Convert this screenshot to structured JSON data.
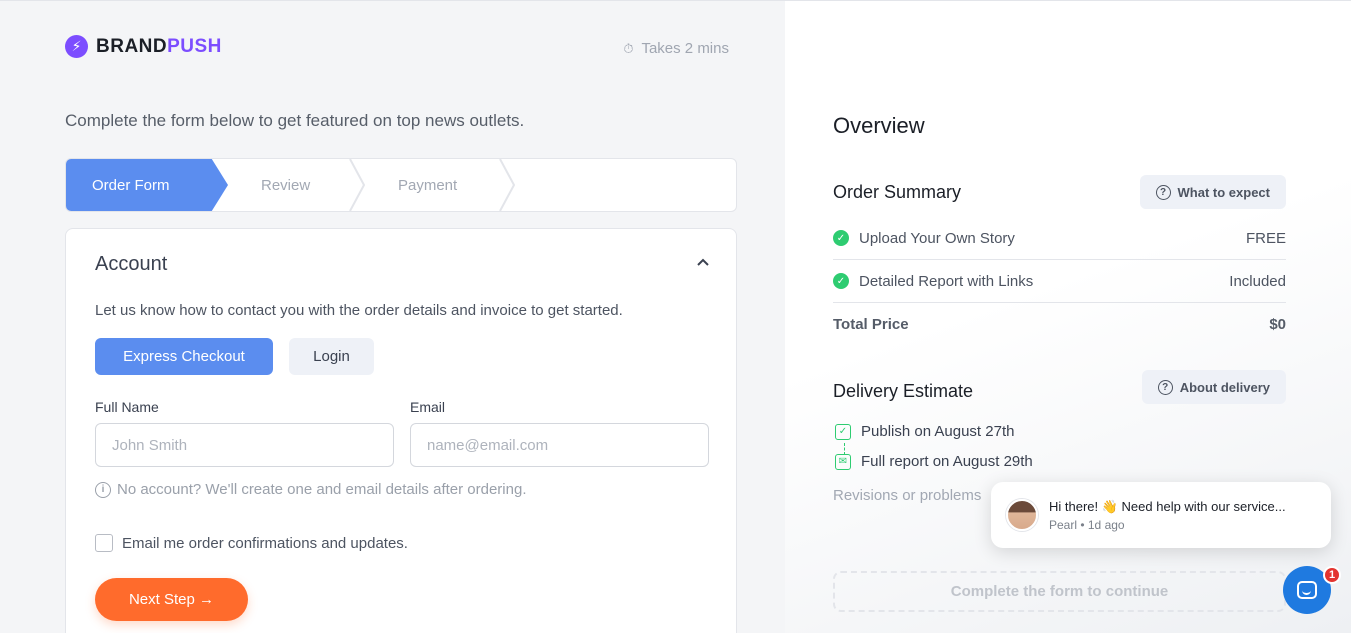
{
  "brand": {
    "name_part1": "BRAND",
    "name_part2": "PUSH",
    "accent_color": "#7c4dff"
  },
  "takes": {
    "label": "Takes 2 mins"
  },
  "intro": "Complete the form below to get featured on top news outlets.",
  "steps": [
    {
      "label": "Order Form",
      "active": true
    },
    {
      "label": "Review",
      "active": false
    },
    {
      "label": "Payment",
      "active": false
    }
  ],
  "account": {
    "title": "Account",
    "description": "Let us know how to contact you with the order details and invoice to get started.",
    "express_label": "Express Checkout",
    "login_label": "Login",
    "full_name": {
      "label": "Full Name",
      "placeholder": "John Smith",
      "value": ""
    },
    "email": {
      "label": "Email",
      "placeholder": "name@email.com",
      "value": ""
    },
    "hint": "No account? We'll create one and email details after ordering.",
    "updates_checkbox": {
      "label": "Email me order confirmations and updates.",
      "checked": false
    },
    "next_label": "Next Step →"
  },
  "overview": {
    "title": "Overview",
    "order_summary": {
      "title": "Order Summary",
      "help_label": "What to expect",
      "items": [
        {
          "name": "Upload Your Own Story",
          "value": "FREE"
        },
        {
          "name": "Detailed Report with Links",
          "value": "Included"
        }
      ],
      "total_label": "Total Price",
      "total_value": "$0"
    },
    "delivery": {
      "title": "Delivery Estimate",
      "help_label": "About delivery",
      "publish": "Publish on August 27th",
      "report": "Full report on August 29th",
      "revisions": "Revisions or problems"
    },
    "complete_label": "Complete the form to continue"
  },
  "chat": {
    "message": "Hi there! 👋 Need help with our service...",
    "meta": "Pearl • 1d ago",
    "unread": "1"
  }
}
